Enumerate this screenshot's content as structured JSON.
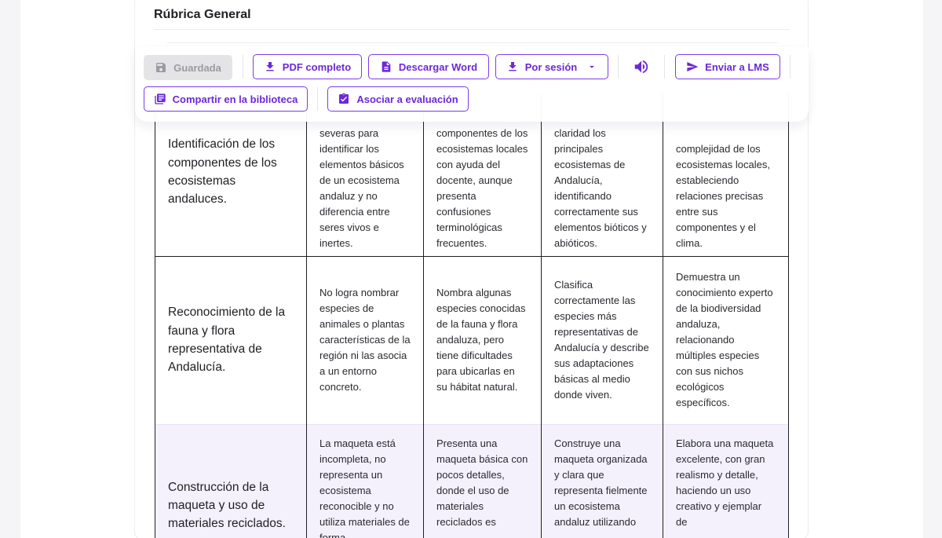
{
  "card": {
    "title": "Rúbrica General"
  },
  "toolbar": {
    "saved_label": "Guardada",
    "pdf_label": "PDF completo",
    "word_label": "Descargar Word",
    "session_label": "Por sesión",
    "lms_label": "Enviar a LMS",
    "library_label": "Compartir en la biblioteca",
    "evaluation_label": "Asociar a evaluación"
  },
  "icons": {
    "save": "save-icon",
    "download": "download-icon",
    "document": "document-icon",
    "caret": "caret-down-icon",
    "volume": "volume-icon",
    "send": "send-icon",
    "library": "library-icon",
    "assignment": "assignment-check-icon"
  },
  "colors": {
    "accent": "#7c3aed",
    "accent_text": "#6d28d9",
    "highlight_row": "#f4f1fd",
    "disabled_bg": "#e4e4e7"
  },
  "rubric": {
    "rows": [
      {
        "criterion": "Identificación de los componentes de los ecosistemas andaluces.",
        "levels": [
          "severas para identificar los elementos básicos de un ecosistema andaluz y no diferencia entre seres vivos e inertes.",
          "componentes de los ecosistemas locales con ayuda del docente, aunque presenta confusiones terminológicas frecuentes.",
          "claridad los principales ecosistemas de Andalucía, identificando correctamente sus elementos bióticos y abióticos.",
          "complejidad de los ecosistemas locales, estableciendo relaciones precisas entre sus componentes y el clima."
        ]
      },
      {
        "criterion": "Reconocimiento de la fauna y flora representativa de Andalucía.",
        "levels": [
          "No logra nombrar especies de animales o plantas características de la región ni las asocia a un entorno concreto.",
          "Nombra algunas especies conocidas de la fauna y flora andaluza, pero tiene dificultades para ubicarlas en su hábitat natural.",
          "Clasifica correctamente las especies más representativas de Andalucía y describe sus adaptaciones básicas al medio donde viven.",
          "Demuestra un conocimiento experto de la biodiversidad andaluza, relacionando múltiples especies con sus nichos ecológicos específicos."
        ]
      },
      {
        "criterion": "Construcción de la maqueta y uso de materiales reciclados.",
        "levels": [
          "La maqueta está incompleta, no representa un ecosistema reconocible y no utiliza materiales de forma",
          "Presenta una maqueta básica con pocos detalles, donde el uso de materiales reciclados es",
          "Construye una maqueta organizada y clara que representa fielmente un ecosistema andaluz utilizando",
          "Elabora una maqueta excelente, con gran realismo y detalle, haciendo un uso creativo y ejemplar de"
        ]
      }
    ]
  }
}
